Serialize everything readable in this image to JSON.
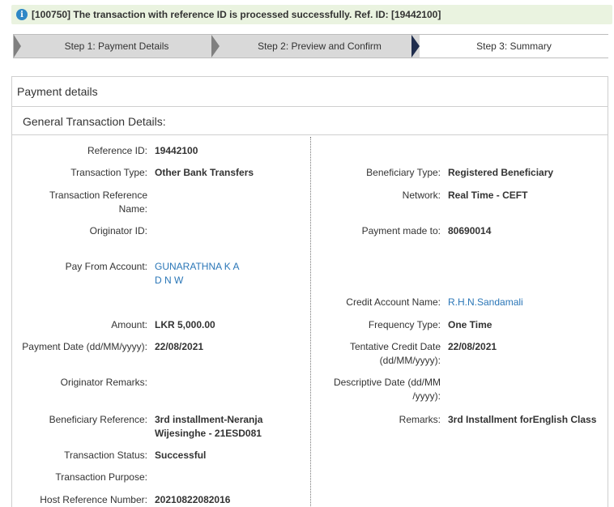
{
  "alert": {
    "message": "[100750] The transaction with reference ID is processed successfully. Ref. ID: [19442100]"
  },
  "steps": [
    {
      "label": "Step 1: Payment Details"
    },
    {
      "label": "Step 2: Preview and Confirm"
    },
    {
      "label": "Step 3: Summary"
    }
  ],
  "panel": {
    "title": "Payment details",
    "section_title": "General Transaction Details:"
  },
  "left": {
    "reference_id": {
      "label": "Reference ID:",
      "value": "19442100"
    },
    "transaction_type": {
      "label": "Transaction Type:",
      "value": "Other Bank Transfers"
    },
    "transaction_reference_name": {
      "label_line1": "Transaction Reference",
      "label_line2": "Name:"
    },
    "originator_id": {
      "label": "Originator ID:"
    },
    "pay_from_account": {
      "label": "Pay From Account:",
      "value_line1": "GUNARATHNA K A",
      "value_line2": "D N W"
    },
    "amount": {
      "label": "Amount:",
      "value": "LKR 5,000.00"
    },
    "payment_date": {
      "label": "Payment Date (dd/MM/yyyy):",
      "value": "22/08/2021"
    },
    "originator_remarks": {
      "label": "Originator Remarks:"
    },
    "beneficiary_reference": {
      "label": "Beneficiary Reference:",
      "value_line1": "3rd installment-Neranja",
      "value_line2": "Wijesinghe - 21ESD081"
    },
    "transaction_status": {
      "label": "Transaction Status:",
      "value": "Successful"
    },
    "transaction_purpose": {
      "label": "Transaction Purpose:"
    },
    "host_reference_number": {
      "label": "Host Reference Number:",
      "value": "20210822082016"
    }
  },
  "right": {
    "beneficiary_type": {
      "label": "Beneficiary Type:",
      "value": "Registered Beneficiary"
    },
    "network": {
      "label": "Network:",
      "value": "Real Time - CEFT"
    },
    "payment_made_to": {
      "label": "Payment made to:",
      "value": "80690014"
    },
    "credit_account_name": {
      "label": "Credit Account Name:",
      "value": "R.H.N.Sandamali"
    },
    "frequency_type": {
      "label": "Frequency Type:",
      "value": "One Time"
    },
    "tentative_credit_date": {
      "label_line1": "Tentative Credit Date",
      "label_line2": "(dd/MM/yyyy):",
      "value": "22/08/2021"
    },
    "descriptive_date": {
      "label_line1": "Descriptive Date (dd/MM",
      "label_line2": "/yyyy):"
    },
    "remarks": {
      "label": "Remarks:",
      "value": "3rd Installment forEnglish Class"
    }
  },
  "colors": {
    "alert_bg": "#eaf3e0",
    "info_icon": "#2f88c6",
    "link": "#2a76b7",
    "active_step_arrow": "#1f2d4d"
  }
}
